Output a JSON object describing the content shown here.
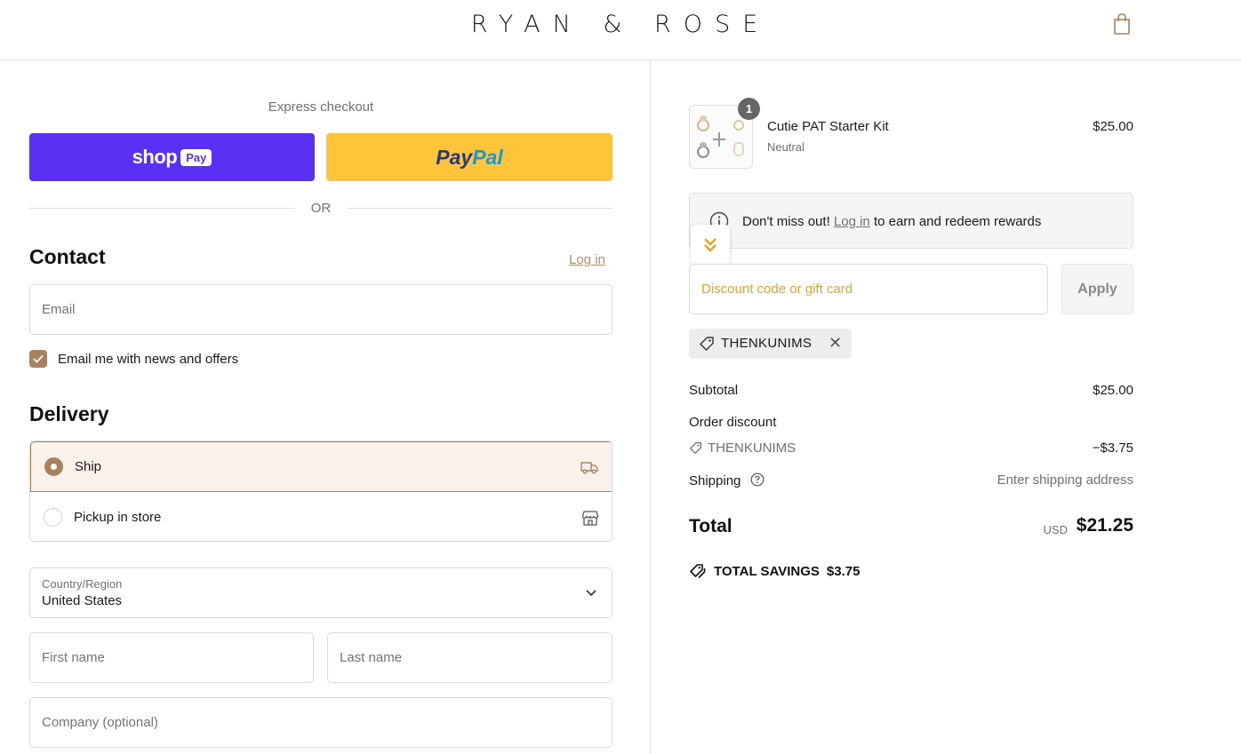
{
  "header": {
    "brand": "RYAN & ROSE",
    "cart_icon": "shopping-bag-icon"
  },
  "express": {
    "label": "Express checkout",
    "shop_pay": {
      "word": "shop",
      "badge": "Pay"
    },
    "paypal": {
      "part1": "Pay",
      "part2": "Pal"
    },
    "divider": "OR"
  },
  "contact": {
    "title": "Contact",
    "login_label": "Log in",
    "email_placeholder": "Email",
    "newsletter_label": "Email me with news and offers",
    "newsletter_checked": true
  },
  "delivery": {
    "title": "Delivery",
    "options": [
      {
        "label": "Ship",
        "selected": true,
        "icon": "truck-icon"
      },
      {
        "label": "Pickup in store",
        "selected": false,
        "icon": "store-icon"
      }
    ],
    "country_caption": "Country/Region",
    "country_value": "United States",
    "first_name_placeholder": "First name",
    "last_name_placeholder": "Last name",
    "company_placeholder": "Company (optional)"
  },
  "order": {
    "item": {
      "name": "Cutie PAT Starter Kit",
      "variant": "Neutral",
      "price": "$25.00",
      "quantity": "1"
    },
    "rewards": {
      "before": "Don't miss out! ",
      "link": "Log in",
      "after": " to earn and redeem rewards"
    },
    "discount_placeholder": "Discount code or gift card",
    "apply_label": "Apply",
    "applied_code": "THENKUNIMS",
    "summary": {
      "subtotal_label": "Subtotal",
      "subtotal_value": "$25.00",
      "order_discount_label": "Order discount",
      "discount_code": "THENKUNIMS",
      "discount_value": "−$3.75",
      "shipping_label": "Shipping",
      "shipping_value": "Enter shipping address",
      "total_label": "Total",
      "currency": "USD",
      "total_value": "$21.25",
      "savings_label": "TOTAL SAVINGS",
      "savings_value": "$3.75"
    }
  },
  "colors": {
    "accent": "#a8825f",
    "shop_pay": "#5a31f4",
    "paypal": "#ffc439",
    "discount_placeholder": "#e3a32b"
  }
}
